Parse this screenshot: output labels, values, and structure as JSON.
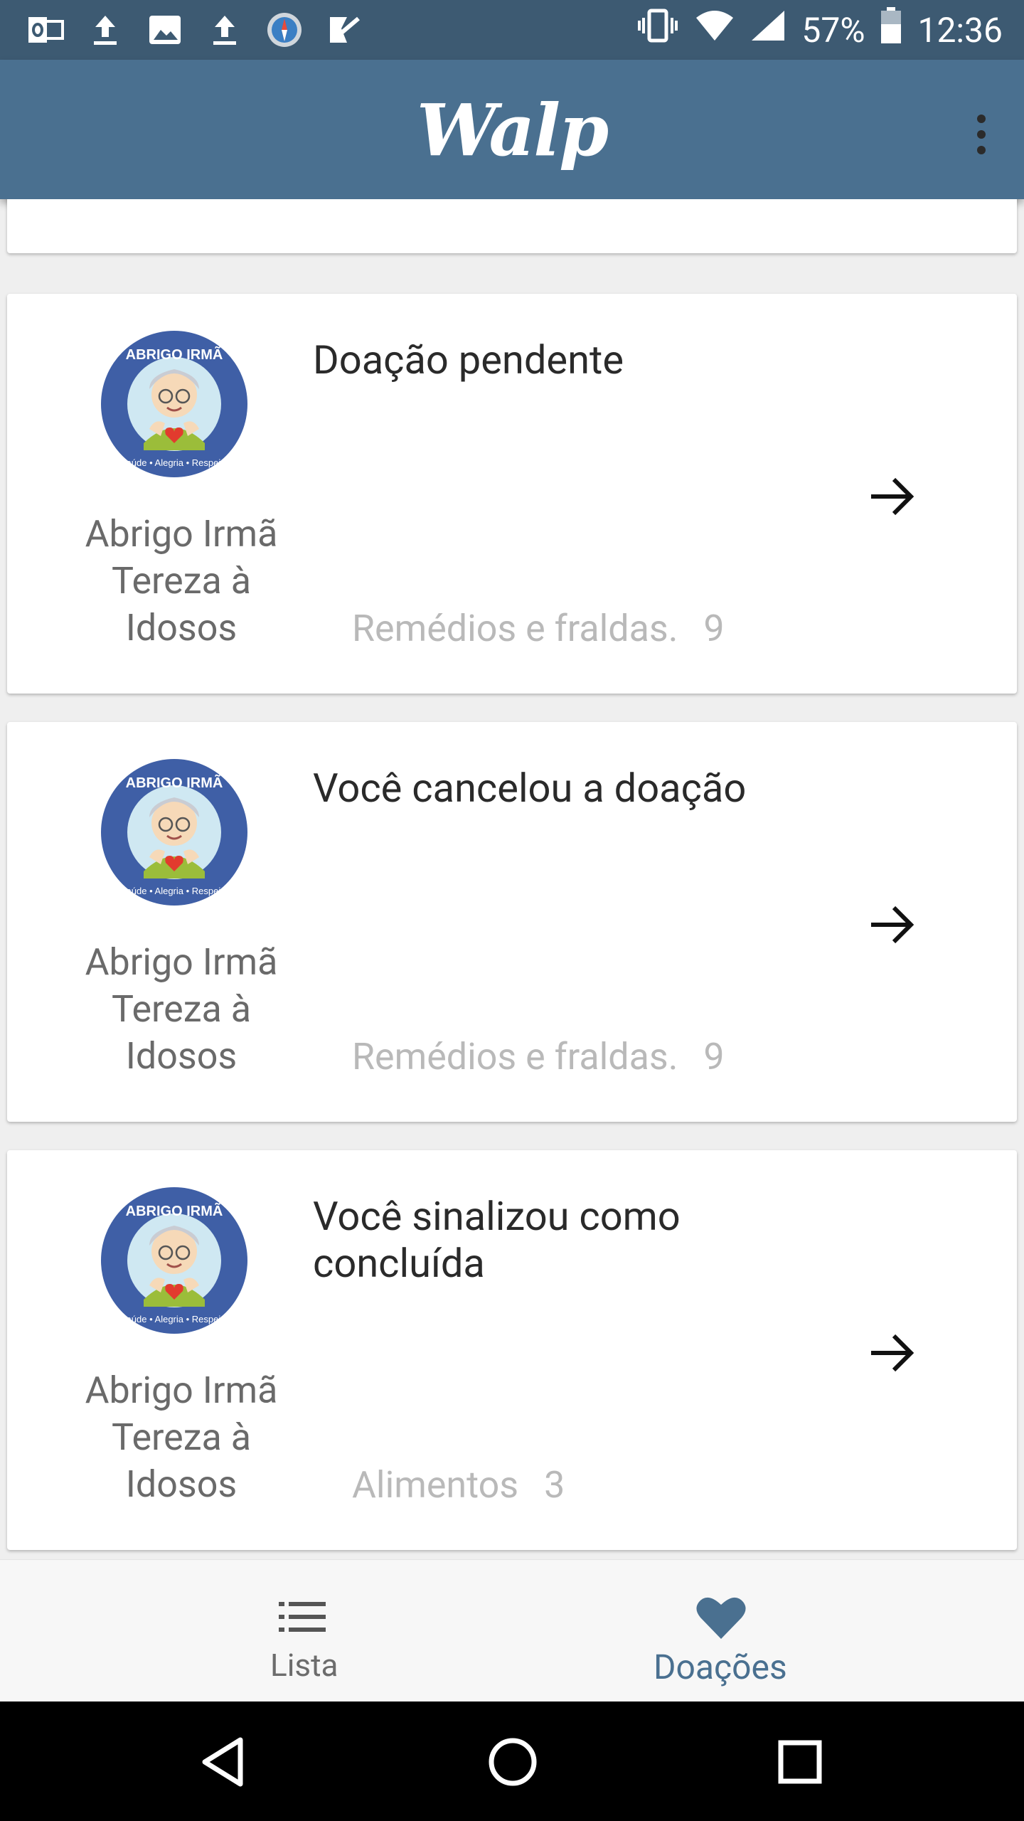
{
  "status_bar": {
    "battery_percent": "57%",
    "time": "12:36",
    "left_icons": [
      "outlook-icon",
      "upload-icon",
      "image-icon",
      "upload-icon",
      "compass-icon",
      "todo-check-icon"
    ],
    "right_icons": [
      "vibrate-icon",
      "wifi-icon",
      "signal-icon",
      "battery-icon"
    ]
  },
  "app_bar": {
    "title": "Walp",
    "menu_icon": "more-vert-icon",
    "background": "#4a7090"
  },
  "donations": [
    {
      "org_name": "Abrigo Irmã Tereza à Idosos",
      "status": "Doação pendente",
      "items": "Remédios e fraldas.",
      "count": "9"
    },
    {
      "org_name": "Abrigo Irmã Tereza à Idosos",
      "status": "Você cancelou a doação",
      "items": "Remédios e fraldas.",
      "count": "9"
    },
    {
      "org_name": "Abrigo Irmã Tereza à Idosos",
      "status": "Você sinalizou como concluída",
      "items": "Alimentos",
      "count": "3"
    }
  ],
  "org_logo": {
    "ring_text_top": "ABRIGO IRMÃ TEREZA",
    "ring_text_bottom": "Saúde • Alegria • Respeito"
  },
  "bottom_nav": {
    "tabs": [
      {
        "label": "Lista",
        "icon": "list-icon",
        "active": false
      },
      {
        "label": "Doações",
        "icon": "heart-icon",
        "active": true
      }
    ],
    "active_color": "#4a7090"
  },
  "system_nav": {
    "buttons": [
      "back-icon",
      "home-icon",
      "recents-icon"
    ]
  }
}
